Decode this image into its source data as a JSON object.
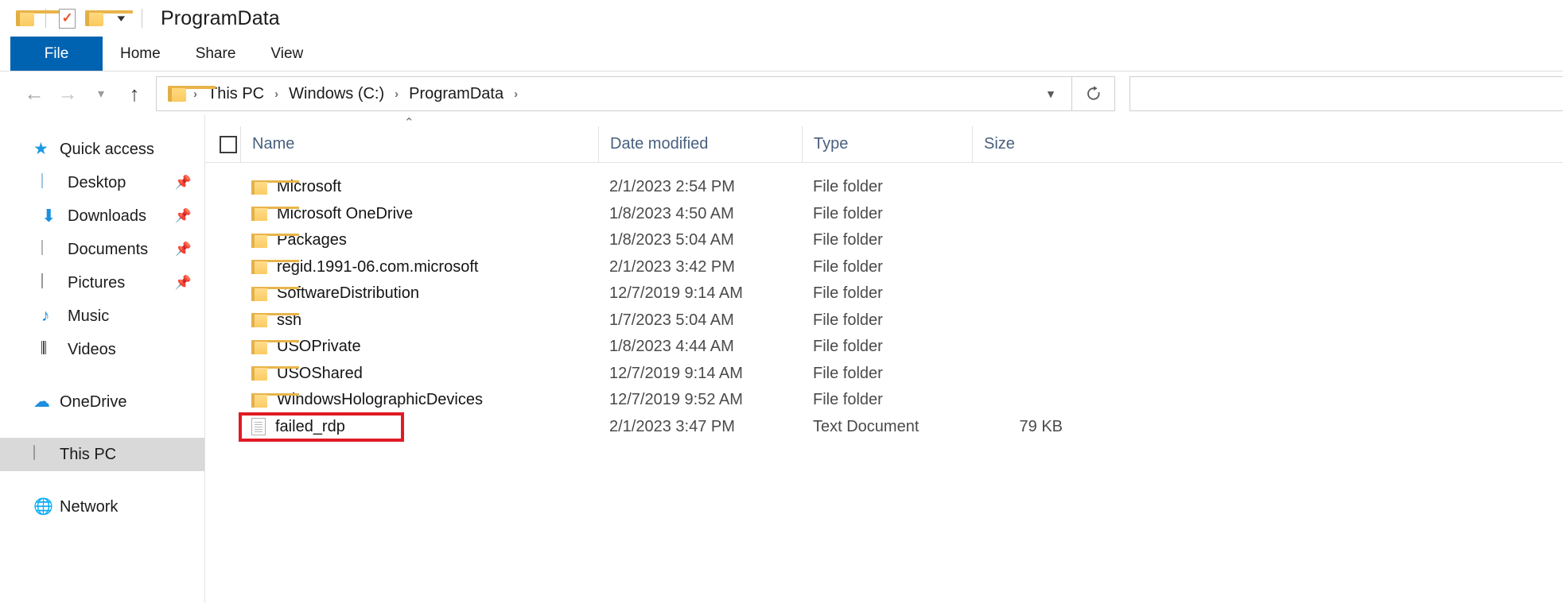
{
  "window": {
    "title": "ProgramData"
  },
  "quick_access_toolbar": {
    "items": [
      {
        "name": "folder-icon",
        "label": ""
      },
      {
        "name": "properties-icon",
        "label": ""
      },
      {
        "name": "new-folder-icon",
        "label": ""
      },
      {
        "name": "customize-caret",
        "label": ""
      }
    ]
  },
  "ribbon": {
    "tabs": [
      {
        "label": "File",
        "active": true
      },
      {
        "label": "Home",
        "active": false
      },
      {
        "label": "Share",
        "active": false
      },
      {
        "label": "View",
        "active": false
      }
    ]
  },
  "address_bar": {
    "crumbs": [
      "This PC",
      "Windows (C:)",
      "ProgramData"
    ],
    "separator": "›",
    "search_placeholder": ""
  },
  "sidebar": {
    "items": [
      {
        "label": "Quick access",
        "icon": "star-icon",
        "pinned": false,
        "selected": false,
        "sub": false
      },
      {
        "label": "Desktop",
        "icon": "desktop-icon",
        "pinned": true,
        "selected": false,
        "sub": true
      },
      {
        "label": "Downloads",
        "icon": "download-icon",
        "pinned": true,
        "selected": false,
        "sub": true
      },
      {
        "label": "Documents",
        "icon": "document-icon",
        "pinned": true,
        "selected": false,
        "sub": true
      },
      {
        "label": "Pictures",
        "icon": "picture-icon",
        "pinned": true,
        "selected": false,
        "sub": true
      },
      {
        "label": "Music",
        "icon": "music-icon",
        "pinned": false,
        "selected": false,
        "sub": true
      },
      {
        "label": "Videos",
        "icon": "video-icon",
        "pinned": false,
        "selected": false,
        "sub": true
      },
      {
        "label": "OneDrive",
        "icon": "onedrive-icon",
        "pinned": false,
        "selected": false,
        "sub": false
      },
      {
        "label": "This PC",
        "icon": "pc-icon",
        "pinned": false,
        "selected": true,
        "sub": false
      },
      {
        "label": "Network",
        "icon": "network-icon",
        "pinned": false,
        "selected": false,
        "sub": false
      }
    ],
    "pin_glyph": "📌"
  },
  "file_list": {
    "sort_indicator": "⌃",
    "columns": {
      "name": "Name",
      "date_modified": "Date modified",
      "type": "Type",
      "size": "Size"
    },
    "rows": [
      {
        "name": "Microsoft",
        "date": "2/1/2023 2:54 PM",
        "type": "File folder",
        "size": "",
        "icon": "folder-icon",
        "highlighted": false
      },
      {
        "name": "Microsoft OneDrive",
        "date": "1/8/2023 4:50 AM",
        "type": "File folder",
        "size": "",
        "icon": "folder-icon",
        "highlighted": false
      },
      {
        "name": "Packages",
        "date": "1/8/2023 5:04 AM",
        "type": "File folder",
        "size": "",
        "icon": "folder-icon",
        "highlighted": false
      },
      {
        "name": "regid.1991-06.com.microsoft",
        "date": "2/1/2023 3:42 PM",
        "type": "File folder",
        "size": "",
        "icon": "folder-icon",
        "highlighted": false
      },
      {
        "name": "SoftwareDistribution",
        "date": "12/7/2019 9:14 AM",
        "type": "File folder",
        "size": "",
        "icon": "folder-icon",
        "highlighted": false
      },
      {
        "name": "ssh",
        "date": "1/7/2023 5:04 AM",
        "type": "File folder",
        "size": "",
        "icon": "folder-icon",
        "highlighted": false
      },
      {
        "name": "USOPrivate",
        "date": "1/8/2023 4:44 AM",
        "type": "File folder",
        "size": "",
        "icon": "folder-icon",
        "highlighted": false
      },
      {
        "name": "USOShared",
        "date": "12/7/2019 9:14 AM",
        "type": "File folder",
        "size": "",
        "icon": "folder-icon",
        "highlighted": false
      },
      {
        "name": "WindowsHolographicDevices",
        "date": "12/7/2019 9:52 AM",
        "type": "File folder",
        "size": "",
        "icon": "folder-icon",
        "highlighted": false
      },
      {
        "name": "failed_rdp",
        "date": "2/1/2023 3:47 PM",
        "type": "Text Document",
        "size": "79 KB",
        "icon": "text-document-icon",
        "highlighted": true
      }
    ]
  },
  "colors": {
    "accent": "#0063b1",
    "header_text": "#48607e",
    "annotation": "#e01b24",
    "selection": "#d9d9d9"
  }
}
